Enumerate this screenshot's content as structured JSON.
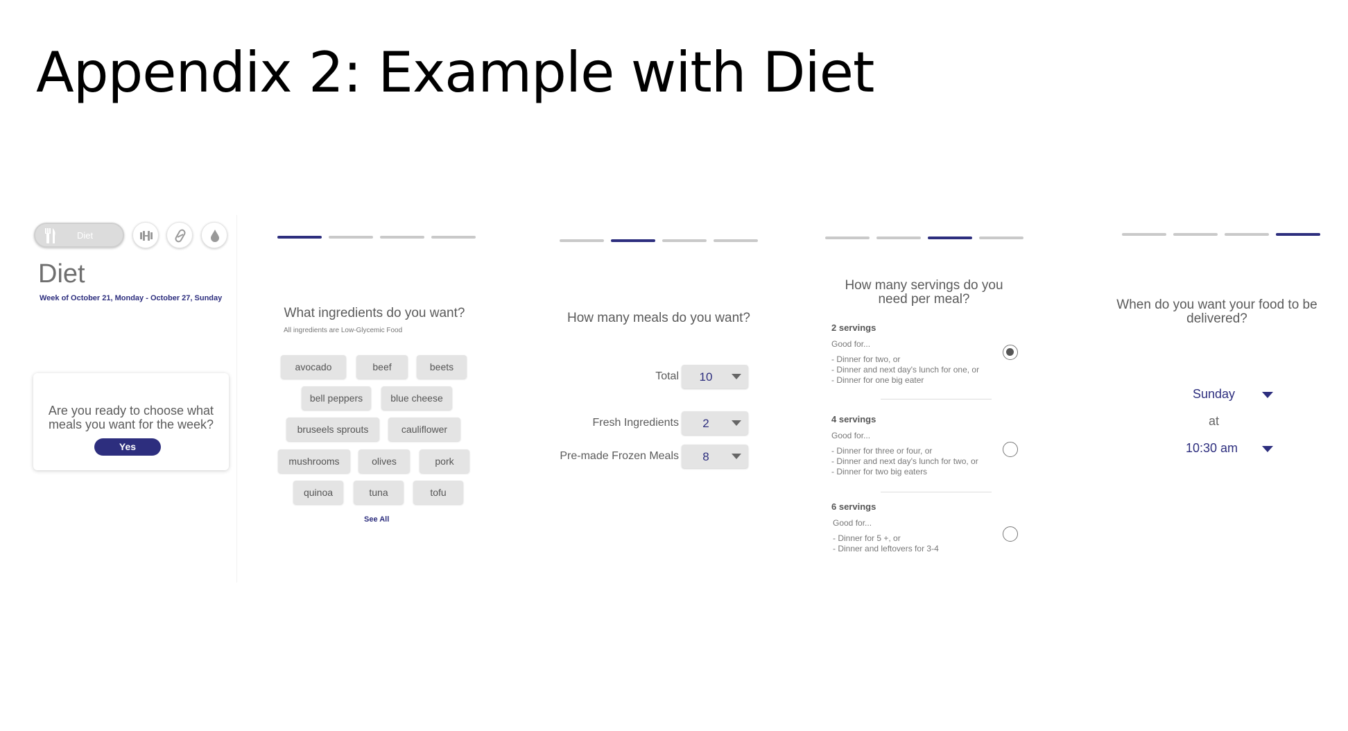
{
  "slide": {
    "title": "Appendix 2: Example with Diet"
  },
  "diet_screen": {
    "tab_label": "Diet",
    "tab_icons": [
      "fork-knife-icon",
      "dumbbell-icon",
      "pill-icon",
      "water-drop-icon"
    ],
    "heading": "Diet",
    "week": "Week of October 21, Monday - October 27, Sunday",
    "prompt": "Are you ready to choose what meals you want for the week?",
    "yes_label": "Yes"
  },
  "ingredients_screen": {
    "progress_step": 1,
    "progress_total": 4,
    "question": "What ingredients do you want?",
    "note": "All ingredients are Low-Glycemic Food",
    "chips": [
      "avocado",
      "beef",
      "beets",
      "bell peppers",
      "blue cheese",
      "bruseels sprouts",
      "cauliflower",
      "mushrooms",
      "olives",
      "pork",
      "quinoa",
      "tuna",
      "tofu"
    ],
    "see_all": "See All"
  },
  "meals_screen": {
    "progress_step": 2,
    "progress_total": 4,
    "question": "How many meals do you want?",
    "fields": [
      {
        "label": "Total",
        "value": "10"
      },
      {
        "label": "Fresh Ingredients",
        "value": "2"
      },
      {
        "label": "Pre-made Frozen Meals",
        "value": "8"
      }
    ]
  },
  "servings_screen": {
    "progress_step": 3,
    "progress_total": 4,
    "question": "How many servings do you need per meal?",
    "options": [
      {
        "title": "2 servings",
        "good_for": "Good for...",
        "lines": [
          "- Dinner for two, or",
          "- Dinner and next day's lunch for one, or",
          "- Dinner for one big eater"
        ],
        "selected": true
      },
      {
        "title": "4 servings",
        "good_for": "Good for...",
        "lines": [
          "- Dinner for three or four, or",
          "- Dinner and next day's lunch for two, or",
          "- Dinner for two big eaters"
        ],
        "selected": false
      },
      {
        "title": "6 servings",
        "good_for": "Good for...",
        "lines": [
          "- Dinner for 5 +, or",
          "- Dinner and leftovers for 3-4"
        ],
        "selected": false
      }
    ]
  },
  "delivery_screen": {
    "progress_step": 4,
    "progress_total": 4,
    "question": "When do you want your food to be delivered?",
    "day": "Sunday",
    "at": "at",
    "time": "10:30 am"
  },
  "colors": {
    "accent": "#2d2e7e",
    "chip": "#e4e4e4",
    "inactive_dash": "#c9c9c9"
  }
}
